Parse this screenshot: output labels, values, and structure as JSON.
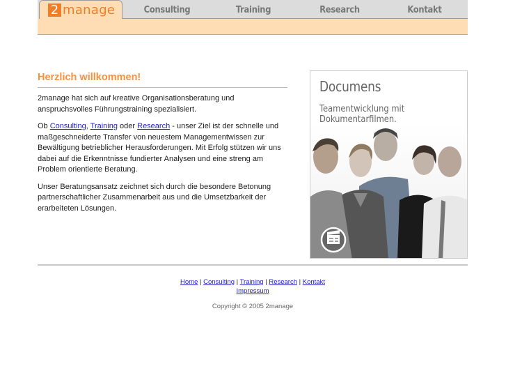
{
  "nav": {
    "logo_digit": "2",
    "logo_text": "manage",
    "tabs": [
      {
        "label": "Consulting"
      },
      {
        "label": "Training"
      },
      {
        "label": "Research"
      },
      {
        "label": "Kontakt"
      }
    ]
  },
  "welcome": {
    "title": "Herzlich willkommen!",
    "p1": "2manage hat sich auf kreative Organisationsberatung und anspruchsvolles Führungstraining spezialisiert.",
    "p2_prefix": "Ob ",
    "p2_link1": "Consulting",
    "p2_sep1": ", ",
    "p2_link2": "Training",
    "p2_sep2": " oder ",
    "p2_link3": "Research",
    "p2_rest": " - unser Ziel ist der schnelle und maßgeschneiderte Transfer von neuestem Managementwissen zur Bewältigung betrieblicher Herausforderungen. Mit Erfolg stützen wir uns dabei auf die Erkenntnisse fundierter Analysen und eine streng am Problem orientierte Beratung.",
    "p3": "Unser Beratungsansatz zeichnet sich durch die besondere Betonung partnerschaftlicher Zusammenarbeit aus und die Umsetzbarkeit der erarbeiteten Lösungen."
  },
  "promo": {
    "title": "Documens",
    "subtitle_line1": "Teamentwicklung mit",
    "subtitle_line2": "Dokumentarfilmen.",
    "icon": "film-clapper-icon"
  },
  "footer": {
    "links": [
      {
        "label": "Home"
      },
      {
        "label": "Consulting"
      },
      {
        "label": "Training"
      },
      {
        "label": "Research"
      },
      {
        "label": "Kontakt"
      }
    ],
    "separator": " | ",
    "impressum": "Impressum",
    "copyright": "Copyright © 2005 2manage"
  },
  "colors": {
    "accent": "#f07e26",
    "heading": "#f7913e",
    "subbar": "#fedcb4",
    "nav_bg": "#dcdcdc",
    "link": "#2222cc"
  }
}
